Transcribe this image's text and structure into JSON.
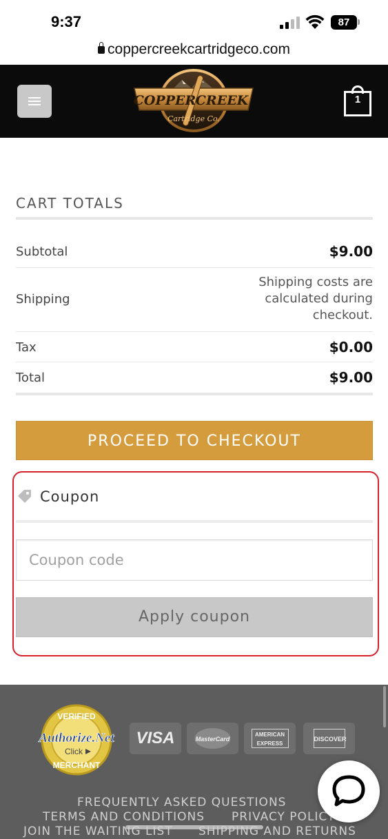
{
  "status_bar": {
    "time": "9:37",
    "battery": "87"
  },
  "browser": {
    "url": "coppercreekcartridgeco.com"
  },
  "header": {
    "logo_text_main": "COPPER CREEK",
    "logo_text_sub": "Cartridge Co.",
    "cart_count": "1",
    "colors": {
      "background": "#0b0b0b",
      "logo_gold": "#c98a3c"
    }
  },
  "cart_totals": {
    "title": "CART TOTALS",
    "rows": [
      {
        "label": "Subtotal",
        "value": "$9.00"
      },
      {
        "label": "Shipping",
        "value_lines": [
          "Shipping costs are",
          "calculated during",
          "checkout."
        ]
      },
      {
        "label": "Tax",
        "value": "$0.00"
      },
      {
        "label": "Total",
        "value": "$9.00"
      }
    ]
  },
  "checkout": {
    "label": "PROCEED TO CHECKOUT",
    "color": "#d59c3d"
  },
  "coupon": {
    "heading": "Coupon",
    "input_placeholder": "Coupon code",
    "input_value": "",
    "apply_label": "Apply coupon",
    "highlight_color": "#d6202c"
  },
  "footer": {
    "seal": {
      "top": "VERIFIED",
      "brand": "Authorize.Net",
      "click": "Click",
      "bottom": "MERCHANT"
    },
    "cards": [
      "VISA",
      "MasterCard",
      "AMERICAN EXPRESS",
      "DISCOVER"
    ],
    "links": [
      "FREQUENTLY ASKED QUESTIONS",
      "TERMS AND CONDITIONS",
      "PRIVACY POLICY",
      "JOIN THE WAITING LIST",
      "SHIPPING AND RETURNS"
    ]
  }
}
